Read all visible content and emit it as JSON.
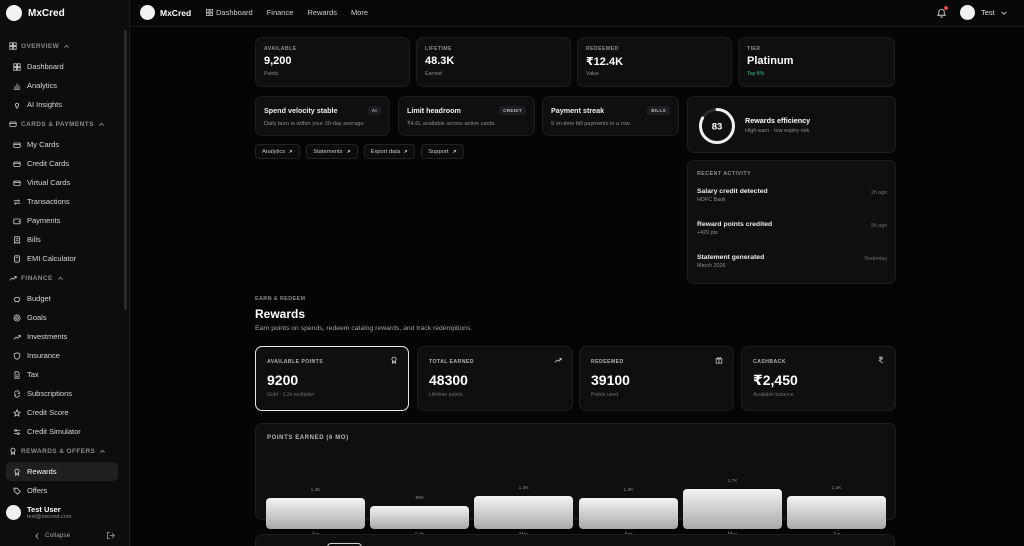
{
  "app": {
    "name": "MxCred"
  },
  "sidebar": {
    "sections": [
      {
        "title": "OVERVIEW",
        "items": [
          {
            "label": "Dashboard",
            "icon": "grid-icon"
          },
          {
            "label": "Analytics",
            "icon": "chart-icon"
          },
          {
            "label": "AI Insights",
            "icon": "bulb-icon"
          }
        ]
      },
      {
        "title": "CARDS & PAYMENTS",
        "items": [
          {
            "label": "My Cards",
            "icon": "card-icon"
          },
          {
            "label": "Credit Cards",
            "icon": "card-icon"
          },
          {
            "label": "Virtual Cards",
            "icon": "card-icon"
          },
          {
            "label": "Transactions",
            "icon": "swap-icon"
          },
          {
            "label": "Payments",
            "icon": "wallet-icon"
          },
          {
            "label": "Bills",
            "icon": "receipt-icon"
          },
          {
            "label": "EMI Calculator",
            "icon": "calculator-icon"
          }
        ]
      },
      {
        "title": "FINANCE",
        "items": [
          {
            "label": "Budget",
            "icon": "piggy-icon"
          },
          {
            "label": "Goals",
            "icon": "target-icon"
          },
          {
            "label": "Investments",
            "icon": "trend-icon"
          },
          {
            "label": "Insurance",
            "icon": "shield-icon"
          },
          {
            "label": "Tax",
            "icon": "document-icon"
          },
          {
            "label": "Subscriptions",
            "icon": "repeat-icon"
          },
          {
            "label": "Credit Score",
            "icon": "star-icon"
          },
          {
            "label": "Credit Simulator",
            "icon": "sliders-icon"
          }
        ]
      },
      {
        "title": "REWARDS & OFFERS",
        "items": [
          {
            "label": "Rewards",
            "icon": "award-icon",
            "active": true
          },
          {
            "label": "Offers",
            "icon": "tag-icon"
          }
        ]
      }
    ],
    "user": {
      "name": "Test User",
      "email": "test@mxcred.com"
    },
    "collapse_label": "Collapse"
  },
  "topbar": {
    "links": [
      "Dashboard",
      "Finance",
      "Rewards",
      "More"
    ],
    "user_label": "Test"
  },
  "stats": [
    {
      "label": "AVAILABLE",
      "value": "9,200",
      "sub": "Points"
    },
    {
      "label": "LIFETIME",
      "value": "48.3K",
      "sub": "Earned"
    },
    {
      "label": "REDEEMED",
      "value": "₹12.4K",
      "sub": "Value"
    },
    {
      "label": "TIER",
      "value": "Platinum",
      "sub": "Top 8%",
      "sub_color": "#38c172"
    }
  ],
  "insights": [
    {
      "title": "Spend velocity stable",
      "badge": "AI",
      "body": "Daily burn is within your 30-day average."
    },
    {
      "title": "Limit headroom",
      "badge": "CREDIT",
      "body": "₹4.6L available across active cards."
    },
    {
      "title": "Payment streak",
      "badge": "BILLS",
      "body": "9 on-time bill payments in a row."
    }
  ],
  "quick_links": [
    "Analytics",
    "Statements",
    "Export data",
    "Support"
  ],
  "efficiency": {
    "score": "83",
    "score_fraction": 0.83,
    "title": "Rewards efficiency",
    "sub": "High earn · low expiry risk"
  },
  "activity": {
    "heading": "RECENT ACTIVITY",
    "items": [
      {
        "title": "Salary credit detected",
        "sub": "HDFC Bank",
        "time": "2h ago"
      },
      {
        "title": "Reward points credited",
        "sub": "+420 pts",
        "time": "5h ago"
      },
      {
        "title": "Statement generated",
        "sub": "March 2026",
        "time": "Yesterday"
      }
    ]
  },
  "rewards": {
    "eyebrow": "EARN & REDEEM",
    "title": "Rewards",
    "subtitle": "Earn points on spends, redeem catalog rewards, and track redemptions.",
    "kpis": [
      {
        "label": "AVAILABLE POINTS",
        "value": "9200",
        "sub": "Gold · 1.2x multiplier",
        "icon": "award-icon",
        "active": true
      },
      {
        "label": "TOTAL EARNED",
        "value": "48300",
        "sub": "Lifetime points",
        "icon": "trend-icon"
      },
      {
        "label": "REDEEMED",
        "value": "39100",
        "sub": "Points used",
        "icon": "gift-icon"
      },
      {
        "label": "CASHBACK",
        "value": "₹2,450",
        "sub": "Available balance",
        "icon": "rupee-icon"
      }
    ]
  },
  "chart_data": {
    "type": "bar",
    "title": "POINTS EARNED (6 MO)",
    "categories": [
      "Jan",
      "Feb",
      "Mar",
      "Apr",
      "May",
      "Jun"
    ],
    "values": [
      1300,
      990,
      1400,
      1300,
      1700,
      1400
    ],
    "value_labels": [
      "1.3K",
      "990",
      "1.4K",
      "1.3K",
      "1.7K",
      "1.4K"
    ],
    "ylim": [
      0,
      1700
    ]
  }
}
